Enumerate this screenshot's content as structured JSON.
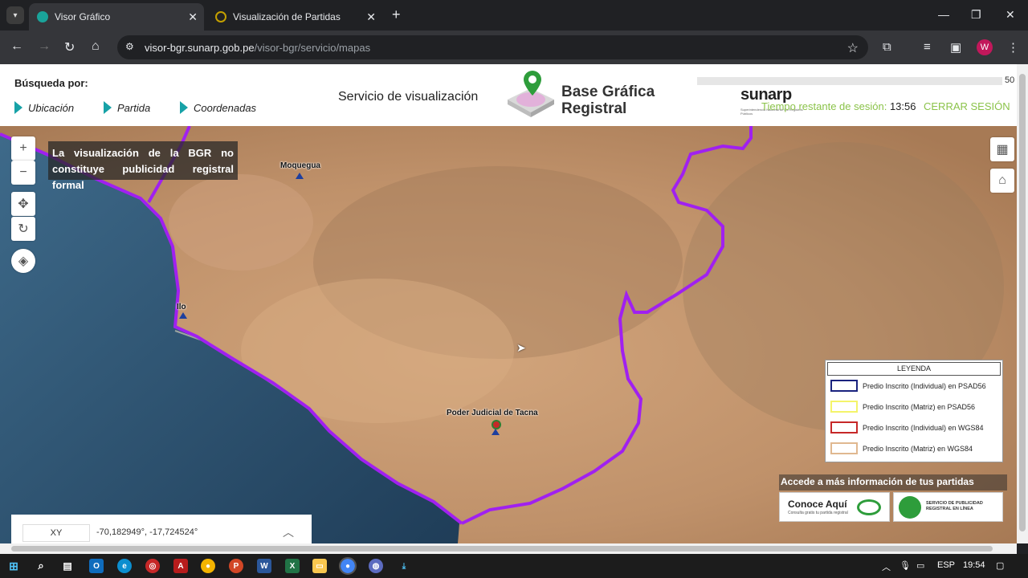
{
  "browser": {
    "tabs": [
      {
        "title": "Visor Gráfico",
        "active": true
      },
      {
        "title": "Visualización de Partidas",
        "active": false
      }
    ],
    "url_domain": "visor-bgr.sunarp.gob.pe",
    "url_path": "/visor-bgr/servicio/mapas",
    "profile_initial": "W",
    "new_tab": "+",
    "close": "✕"
  },
  "header": {
    "busqueda_label": "Búsqueda por:",
    "options": [
      "Ubicación",
      "Partida",
      "Coordenadas"
    ],
    "servicio": "Servicio de visualización",
    "brand_line1": "Base Gráfica",
    "brand_line2": "Registral",
    "sunarp": "sunarp",
    "sunarp_sub": "Superintendencia Nacional de los Registros Públicos",
    "progress_value": "50",
    "sesion_label": "Tiempo restante de sesión:",
    "sesion_time": "13:56",
    "cerrar": "CERRAR SESIÓN"
  },
  "map": {
    "disclaimer": "La visualización de la BGR no constituye publicidad registral formal",
    "places": [
      "Moquegua",
      "Ilo",
      "Poder Judicial de Tacna"
    ],
    "legend": {
      "title": "LEYENDA",
      "items": [
        {
          "label": "Predio Inscrito (Individual) en PSAD56",
          "color": "#1a237e"
        },
        {
          "label": "Predio Inscrito (Matriz) en PSAD56",
          "color": "#f4f46a"
        },
        {
          "label": "Predio Inscrito (Individual) en WGS84",
          "color": "#c62828"
        },
        {
          "label": "Predio Inscrito (Matriz) en WGS84",
          "color": "#e0b890"
        }
      ]
    },
    "accede": "Accede a más información de tus partidas",
    "conoce": "Conoce Aquí",
    "conoce_sub": "Consulta gratis tu partida registral",
    "servicio_pub": "SERVICIO DE PUBLICIDAD REGISTRAL EN LÍNEA",
    "xy_label": "XY",
    "xy_value": "-70,182949°, -17,724524°",
    "boundary_color": "#a020f0"
  },
  "taskbar": {
    "lang": "ESP",
    "time": "19:54"
  }
}
